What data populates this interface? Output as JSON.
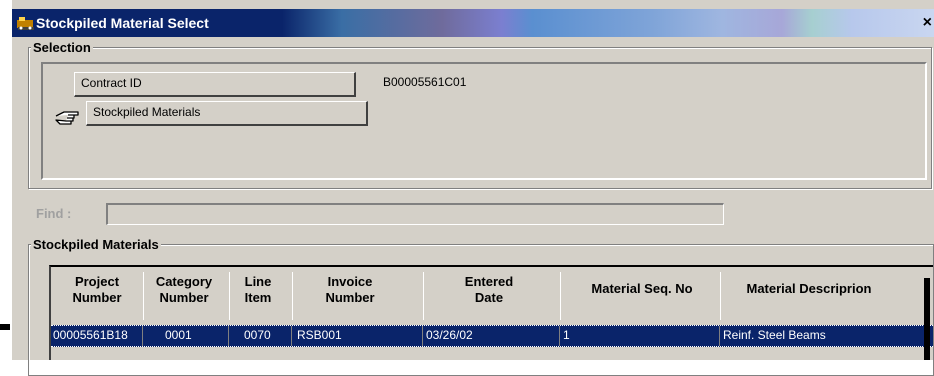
{
  "window": {
    "title": "Stockpiled Material Select",
    "close_label": "×"
  },
  "selection": {
    "group_label": "Selection",
    "contract_button": "Contract ID",
    "contract_value": "B00005561C01",
    "stockpiled_button": "Stockpiled Materials"
  },
  "find": {
    "label": "Find :",
    "value": ""
  },
  "materials": {
    "group_label": "Stockpiled Materials",
    "columns": [
      {
        "line1": "Project",
        "line2": "Number"
      },
      {
        "line1": "Category",
        "line2": "Number"
      },
      {
        "line1": "Line",
        "line2": "Item"
      },
      {
        "line1": "Invoice",
        "line2": "Number"
      },
      {
        "line1": "Entered",
        "line2": "Date"
      },
      {
        "line1": "Material Seq. No",
        "line2": ""
      },
      {
        "line1": "Material Descriprion",
        "line2": ""
      }
    ],
    "rows": [
      [
        "00005561B18",
        "0001",
        "0070",
        "RSB001",
        "03/26/02",
        "1",
        "Reinf. Steel Beams"
      ]
    ]
  },
  "colors": {
    "selection_highlight": "#0a246a",
    "window_face": "#d4d0c8"
  }
}
